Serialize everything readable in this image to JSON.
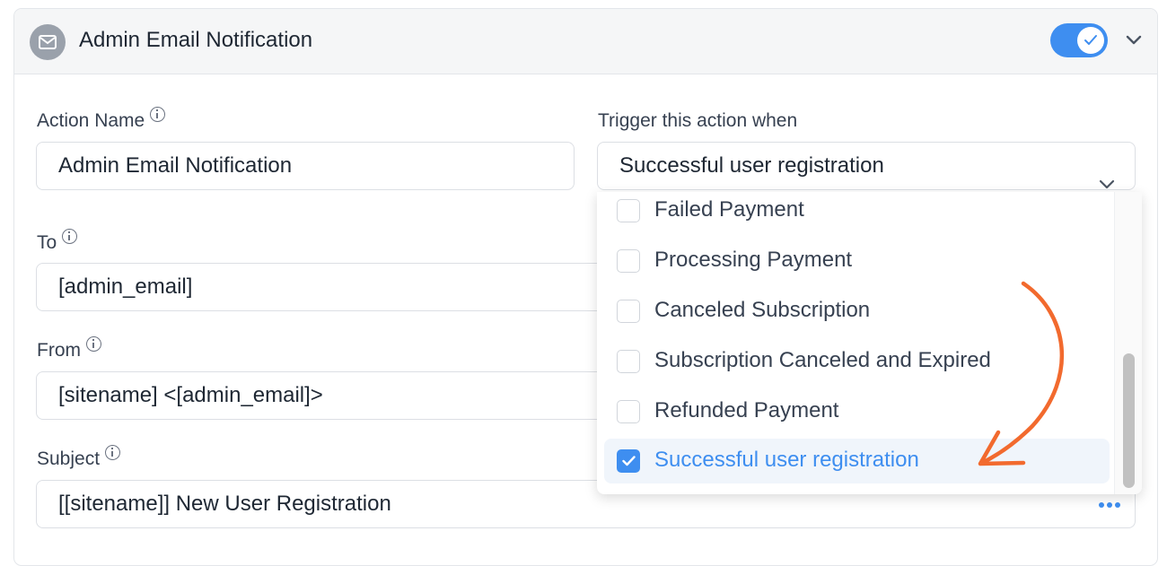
{
  "header": {
    "title": "Admin Email Notification",
    "icon": "mail-icon",
    "toggle_on": true
  },
  "form": {
    "action_name": {
      "label": "Action Name",
      "value": "Admin Email Notification"
    },
    "trigger": {
      "label": "Trigger this action when",
      "value": "Successful user registration"
    },
    "to": {
      "label": "To",
      "value": "[admin_email]"
    },
    "from": {
      "label": "From",
      "value": "[sitename] <[admin_email]>"
    },
    "subject": {
      "label": "Subject",
      "value": "[[sitename]] New User Registration"
    }
  },
  "dropdown": {
    "options": [
      {
        "label": "Failed Payment",
        "checked": false
      },
      {
        "label": "Processing Payment",
        "checked": false
      },
      {
        "label": "Canceled Subscription",
        "checked": false
      },
      {
        "label": "Subscription Canceled and Expired",
        "checked": false
      },
      {
        "label": "Refunded Payment",
        "checked": false
      },
      {
        "label": "Successful user registration",
        "checked": true
      }
    ]
  },
  "colors": {
    "accent": "#3e8ef0",
    "annotation_arrow": "#f26a2e"
  }
}
